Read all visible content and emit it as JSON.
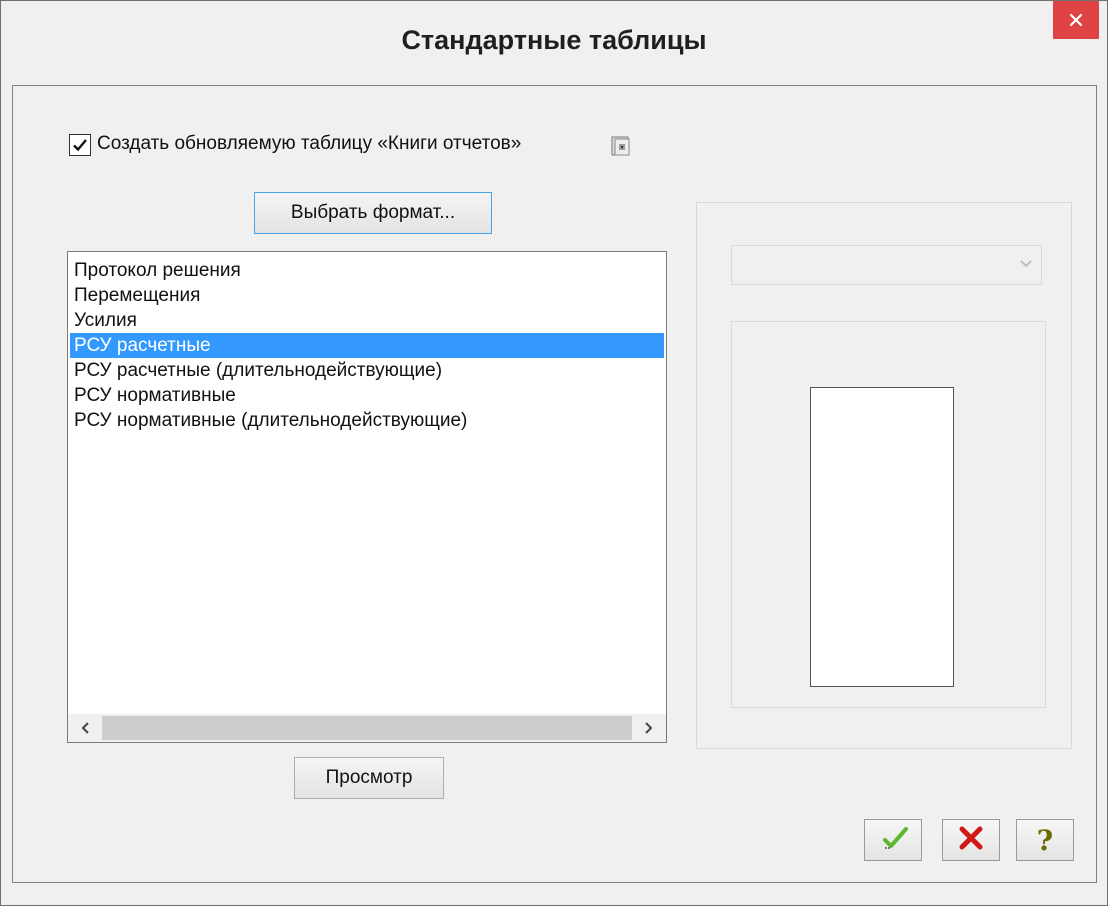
{
  "window": {
    "title": "Стандартные таблицы"
  },
  "checkbox": {
    "label": "Создать обновляемую таблицу «Книги отчетов»",
    "checked": true
  },
  "buttons": {
    "select_format": "Выбрать формат...",
    "preview": "Просмотр"
  },
  "list": {
    "items": [
      "Протокол решения",
      "Перемещения",
      "Усилия",
      "РСУ расчетные",
      "РСУ расчетные (длительнодействующие)",
      "РСУ нормативные",
      "РСУ нормативные (длительнодействующие)"
    ],
    "selected_index": 3
  },
  "dropdown": {
    "value": "",
    "disabled": true
  },
  "icons": {
    "close": "close-icon",
    "book": "book-icon",
    "ok": "checkmark-icon",
    "cancel": "red-x-icon",
    "help": "question-icon"
  },
  "colors": {
    "close_bg": "#e04343",
    "selection": "#3399ff",
    "ok_check": "#5fb82b",
    "cancel_x": "#d01818",
    "help_mark": "#6b6a00"
  },
  "help_glyph": "?"
}
